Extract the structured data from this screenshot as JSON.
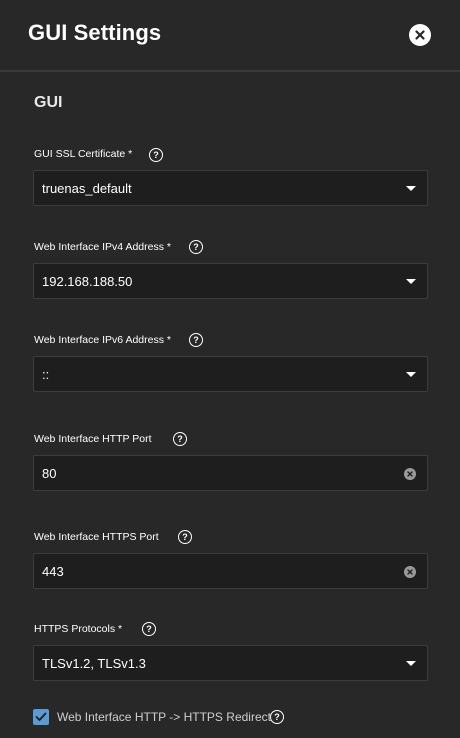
{
  "dialog": {
    "title": "GUI Settings",
    "close_icon": "close-icon"
  },
  "section": {
    "title": "GUI"
  },
  "fields": {
    "ssl_certificate": {
      "label": "GUI SSL Certificate *",
      "value": "truenas_default",
      "control": "select"
    },
    "ipv4_address": {
      "label": "Web Interface IPv4 Address *",
      "value": "192.168.188.50",
      "control": "select"
    },
    "ipv6_address": {
      "label": "Web Interface IPv6 Address *",
      "value": "::",
      "control": "select"
    },
    "http_port": {
      "label": "Web Interface HTTP Port",
      "value": "80",
      "control": "input"
    },
    "https_port": {
      "label": "Web Interface HTTPS Port",
      "value": "443",
      "control": "input"
    },
    "https_protocols": {
      "label": "HTTPS Protocols *",
      "value": "TLSv1.2, TLSv1.3",
      "control": "select"
    }
  },
  "redirect": {
    "label": "Web Interface HTTP -> HTTPS Redirect",
    "checked": true
  },
  "help_glyph": "?",
  "colors": {
    "background": "#282828",
    "input_background": "#1e1e1e",
    "checkbox": "#5c9ad2"
  }
}
